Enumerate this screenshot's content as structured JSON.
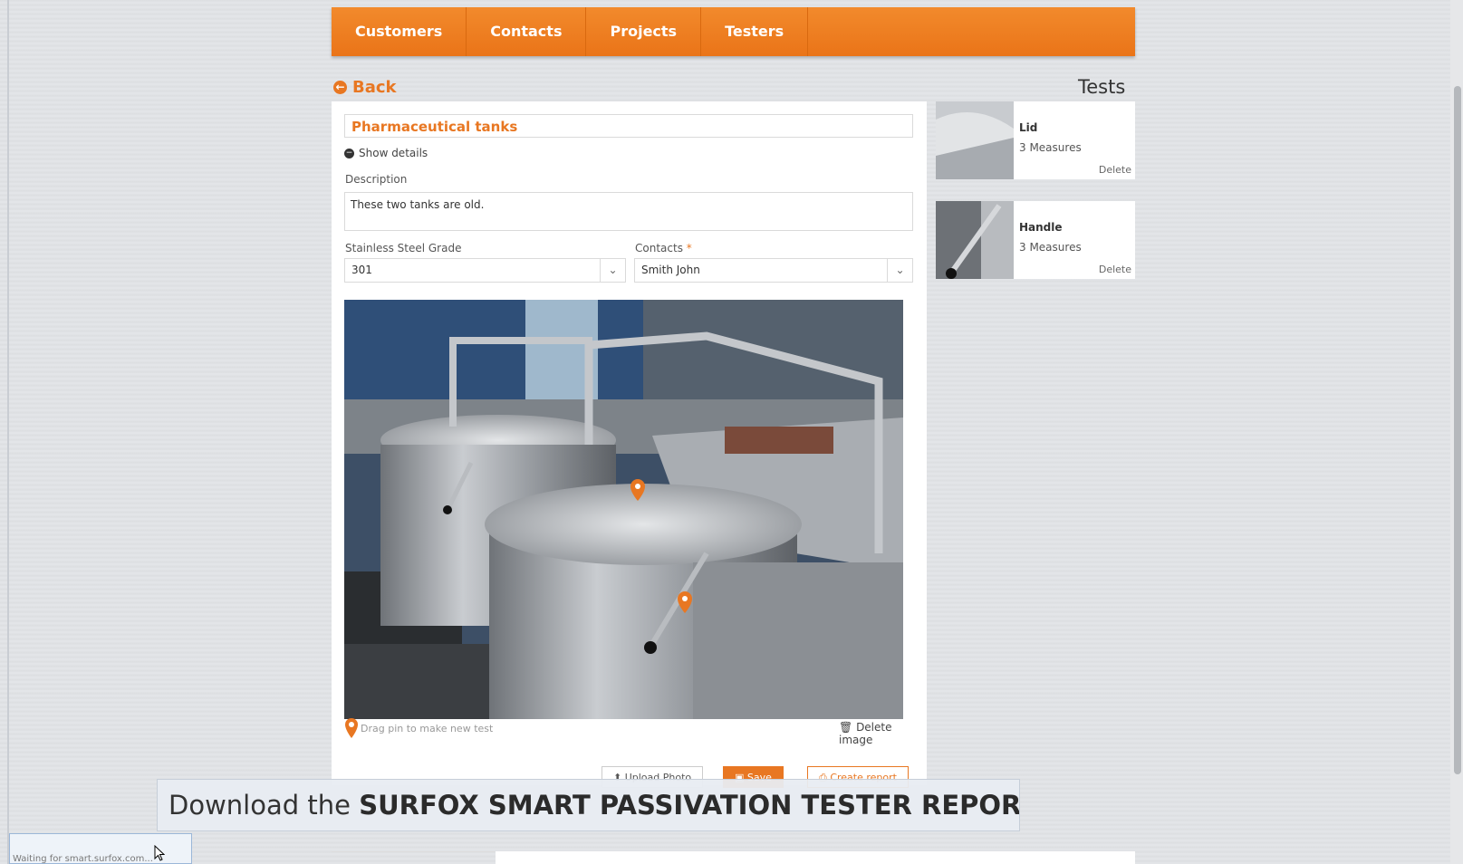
{
  "nav": {
    "items": [
      "Customers",
      "Contacts",
      "Projects",
      "Testers"
    ]
  },
  "back": {
    "label": "Back"
  },
  "tests": {
    "title": "Tests",
    "cards": [
      {
        "name": "Lid",
        "measures": "3 Measures",
        "delete": "Delete"
      },
      {
        "name": "Handle",
        "measures": "3 Measures",
        "delete": "Delete"
      }
    ]
  },
  "form": {
    "title": "Pharmaceutical tanks",
    "show_details": "Show details",
    "description_label": "Description",
    "description_value": "These two tanks are old.",
    "grade_label": "Stainless Steel Grade",
    "grade_value": "301",
    "contacts_label": "Contacts",
    "contacts_required": "*",
    "contacts_value": "Smith John",
    "drag_hint": "Drag pin to make new test",
    "delete_image": "Delete image",
    "buttons": {
      "upload": "Upload Photo",
      "save": "Save",
      "report": "Create report"
    }
  },
  "banner": {
    "prefix": "Download the ",
    "filename": "SURFOX SMART PASSIVATION TESTER REPORT.pdf"
  },
  "status_bar": {
    "text": "Waiting for smart.surfox.com..."
  },
  "colors": {
    "accent": "#e87722"
  }
}
